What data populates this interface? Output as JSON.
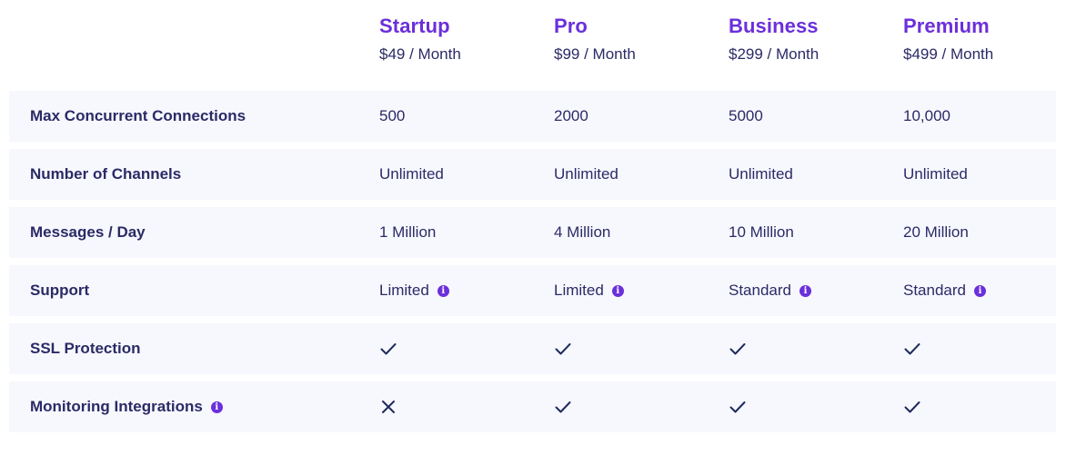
{
  "plans": [
    {
      "name": "Startup",
      "price": "$49 / Month"
    },
    {
      "name": "Pro",
      "price": "$99 / Month"
    },
    {
      "name": "Business",
      "price": "$299 / Month"
    },
    {
      "name": "Premium",
      "price": "$499 / Month"
    }
  ],
  "rows": [
    {
      "label": "Max Concurrent Connections",
      "values": [
        "500",
        "2000",
        "5000",
        "10,000"
      ]
    },
    {
      "label": "Number of Channels",
      "values": [
        "Unlimited",
        "Unlimited",
        "Unlimited",
        "Unlimited"
      ]
    },
    {
      "label": "Messages / Day",
      "values": [
        "1 Million",
        "4 Million",
        "10 Million",
        "20 Million"
      ]
    },
    {
      "label": "Support",
      "values": [
        "Limited",
        "Limited",
        "Standard",
        "Standard"
      ]
    },
    {
      "label": "SSL Protection",
      "values": [
        "check-icon",
        "check-icon",
        "check-icon",
        "check-icon"
      ]
    },
    {
      "label": "Monitoring Integrations",
      "values": [
        "cross-icon",
        "check-icon",
        "check-icon",
        "check-icon"
      ]
    }
  ],
  "icons": {
    "info": "info-icon",
    "info_glyph": "i"
  },
  "colors": {
    "accent": "#6b2fdb",
    "text": "#2b2a66",
    "row_background": "#f7f8fe"
  }
}
